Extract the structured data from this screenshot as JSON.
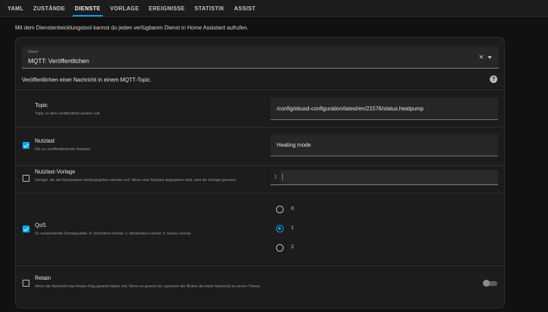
{
  "tabs": [
    {
      "label": "YAML"
    },
    {
      "label": "ZUSTÄNDE"
    },
    {
      "label": "DIENSTE",
      "active": true
    },
    {
      "label": "VORLAGE"
    },
    {
      "label": "EREIGNISSE"
    },
    {
      "label": "STATISTIK"
    },
    {
      "label": "ASSIST"
    }
  ],
  "intro_text": "Mit dem Dienstentwicklungstool kannst du jeden verfügbaren Dienst in Home Assistant aufrufen.",
  "service": {
    "caption": "Dienst",
    "value": "MQTT: Veröffentlichen",
    "description": "Veröffentlichen einer Nachricht in einem MQTT-Topic."
  },
  "fields": {
    "topic": {
      "label": "Topic",
      "help": "Topic, in dem veröffentlicht werden soll.",
      "value": "/config/ebusd-configuration/latest/en/21576/status.heatpump"
    },
    "payload": {
      "label": "Nutzlast",
      "help": "Die zu veröffentlichende Nutzlast.",
      "checked": true,
      "value": "Heating mode"
    },
    "payload_template": {
      "label": "Nutzlast-Vorlage",
      "help": "Vorlage, die als Nutzlastwert wiedergegeben werden soll. Wenn eine Nutzlast angegeben wird, wird die Vorlage ignoriert.",
      "checked": false,
      "line_number": "1"
    },
    "qos": {
      "label": "QoS",
      "help": "Zu verwendende Dienstqualität. 0: Höchstens einmal. 1: Mindestens einmal. 2: Genau einmal.",
      "checked": true,
      "options": [
        "0",
        "1",
        "2"
      ],
      "selected": "1"
    },
    "retain": {
      "label": "Retain",
      "help": "Wenn die Nachricht das Retain-Flag gesetzt haben soll. Wenn es gesetzt ist, speichert der Broker die letzte Nachricht zu einem Thema.",
      "checked": false,
      "enabled": false
    }
  },
  "colors": {
    "accent": "#03a9f4",
    "background": "#111111",
    "card": "#1c1c1c"
  },
  "icons": {
    "clear": "close-icon",
    "dropdown": "chevron-down-icon",
    "help": "help-circle-icon"
  }
}
